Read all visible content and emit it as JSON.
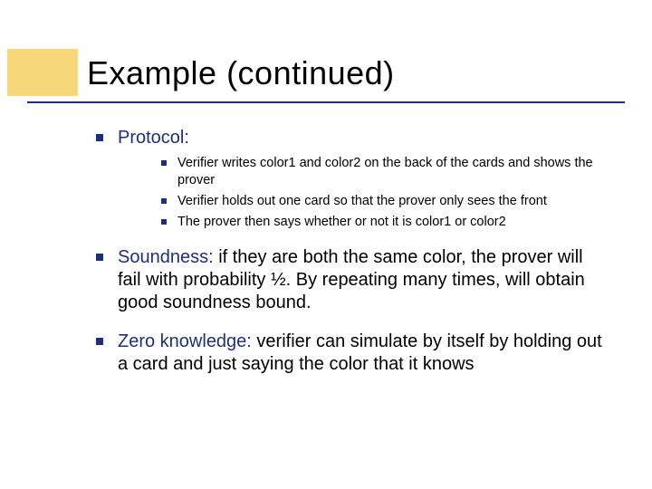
{
  "title": "Example (continued)",
  "bullets": {
    "b1": {
      "label": "Protocol:",
      "items": [
        "Verifier writes color1 and color2 on the back of the cards and shows the prover",
        "Verifier holds out one card so that the prover only sees the front",
        "The prover then says whether or not it is color1 or color2"
      ]
    },
    "b2": {
      "emph": "Soundness:",
      "rest": " if they are both the same color, the prover will fail with probability ½. By repeating many times, will obtain good soundness bound."
    },
    "b3": {
      "emph": "Zero knowledge:",
      "rest": " verifier can simulate by itself by holding out a card and just saying the color that it knows"
    }
  }
}
